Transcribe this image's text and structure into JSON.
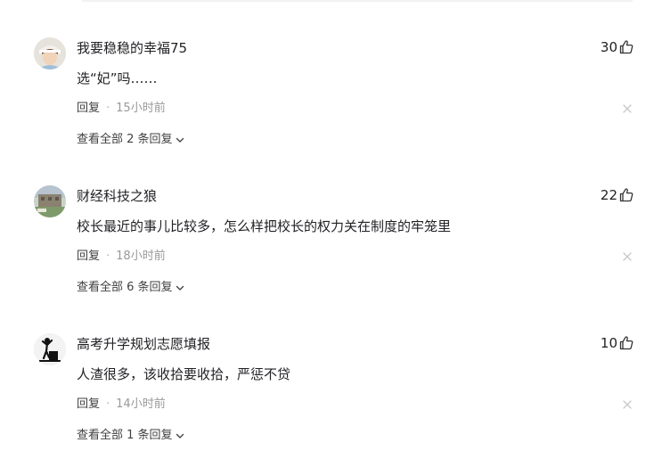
{
  "comments": [
    {
      "username": "我要稳稳的幸福75",
      "likes": "30",
      "text": "选“妃”吗……",
      "reply_label": "回复",
      "time": "15小时前",
      "view_replies": "查看全部 2 条回复"
    },
    {
      "username": "财经科技之狼",
      "likes": "22",
      "text": "校长最近的事儿比较多，怎么样把校长的权力关在制度的牢笼里",
      "reply_label": "回复",
      "time": "18小时前",
      "view_replies": "查看全部 6 条回复"
    },
    {
      "username": "高考升学规划志愿填报",
      "likes": "10",
      "text": "人渣很多，该收拾要收拾，严惩不贷",
      "reply_label": "回复",
      "time": "14小时前",
      "view_replies": "查看全部 1 条回复"
    }
  ],
  "separator": "·",
  "icons": {
    "like": "thumbs-up-icon",
    "close": "close-icon",
    "expand": "chevron-down-icon"
  },
  "colors": {
    "text": "#222226",
    "muted": "#999999",
    "icon": "#c8c8c8"
  }
}
